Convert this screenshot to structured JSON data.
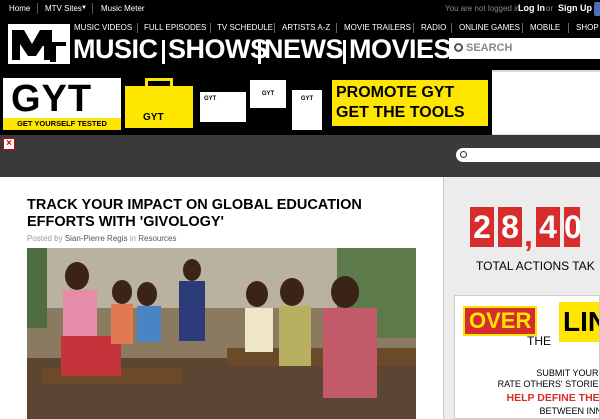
{
  "topbar": {
    "home": "Home",
    "mtv_sites": "MTV Sites",
    "music_meter": "Music Meter",
    "not_logged_in": "You are not logged in.",
    "log_in": "Log In",
    "or": "or",
    "sign_up": "Sign Up"
  },
  "subnav": [
    "MUSIC VIDEOS",
    "FULL EPISODES",
    "TV SCHEDULE",
    "ARTISTS A-Z",
    "MOVIE TRAILERS",
    "RADIO",
    "ONLINE GAMES",
    "MOBILE",
    "SHOP"
  ],
  "mainnav": [
    "MUSIC",
    "SHOWS",
    "NEWS",
    "MOVIES"
  ],
  "search": {
    "placeholder": "SEARCH"
  },
  "banner": {
    "gyt": "GYT",
    "gyt_strip": "GET YOURSELF TESTED",
    "toolbox_label": "GYT",
    "card_label": "GYT",
    "shirt_label": "GYT",
    "poster_label": "GYT",
    "promo_line1": "PROMOTE GYT",
    "promo_line2": "GET THE TOOLS HERE"
  },
  "close_button": "×",
  "article": {
    "title": "TRACK YOUR IMPACT ON GLOBAL EDUCATION EFFORTS WITH 'GIVOLOGY'",
    "posted_by": "Posted by",
    "author": "Sian-Pierre Regis",
    "in": "in",
    "category": "Resources"
  },
  "sidebar": {
    "counter_digits": [
      "2",
      "8",
      "4",
      "0"
    ],
    "counter_label": "TOTAL ACTIONS TAK",
    "promo_over": "OVER",
    "promo_the": "THE",
    "promo_limit": "LIN",
    "promo_submit_1": "SUBMIT YOUR S",
    "promo_submit_2": "RATE OTHERS' STORIES,",
    "promo_help": "HELP DEFINE THE L",
    "promo_between": "BETWEEN INNO"
  },
  "colors": {
    "brand_yellow": "#ffe600",
    "counter_red": "#d62c2c"
  }
}
